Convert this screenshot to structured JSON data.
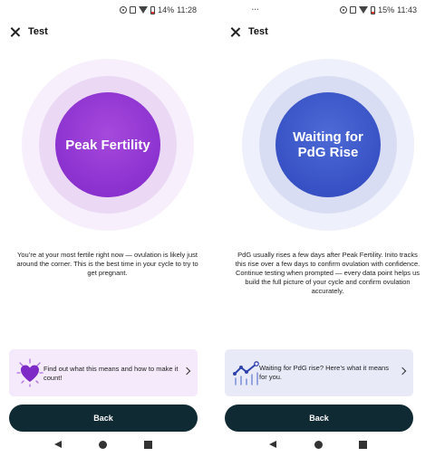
{
  "screens": [
    {
      "status": {
        "battery": "14%",
        "time": "11:28"
      },
      "header": {
        "title": "Test"
      },
      "phase_label": "Peak Fertility",
      "description": "You’re at your most fertile right now — ovulation is likely just around the corner. This is the best time in your cycle to try to get pregnant.",
      "card": {
        "icon": "heart-icon",
        "text": "Find out what this means and how to make it count!"
      },
      "back_label": "Back",
      "colors": {
        "accent": "#8a2fd1",
        "card_bg": "#f4eafb"
      }
    },
    {
      "status": {
        "battery": "15%",
        "time": "11:43"
      },
      "header": {
        "title": "Test"
      },
      "phase_label": "Waiting for PdG Rise",
      "description": "PdG usually rises a few days after Peak Fertility. Inito tracks this rise over a few days to confirm ovulation with confidence. Continue testing when prompted — every data point helps us build the full picture of your cycle and confirm ovulation accurately.",
      "card": {
        "icon": "trend-chart-icon",
        "text": "Waiting for PdG rise? Here’s what it means for you."
      },
      "back_label": "Back",
      "colors": {
        "accent": "#3a55c9",
        "card_bg": "#e8eaf8"
      }
    }
  ]
}
